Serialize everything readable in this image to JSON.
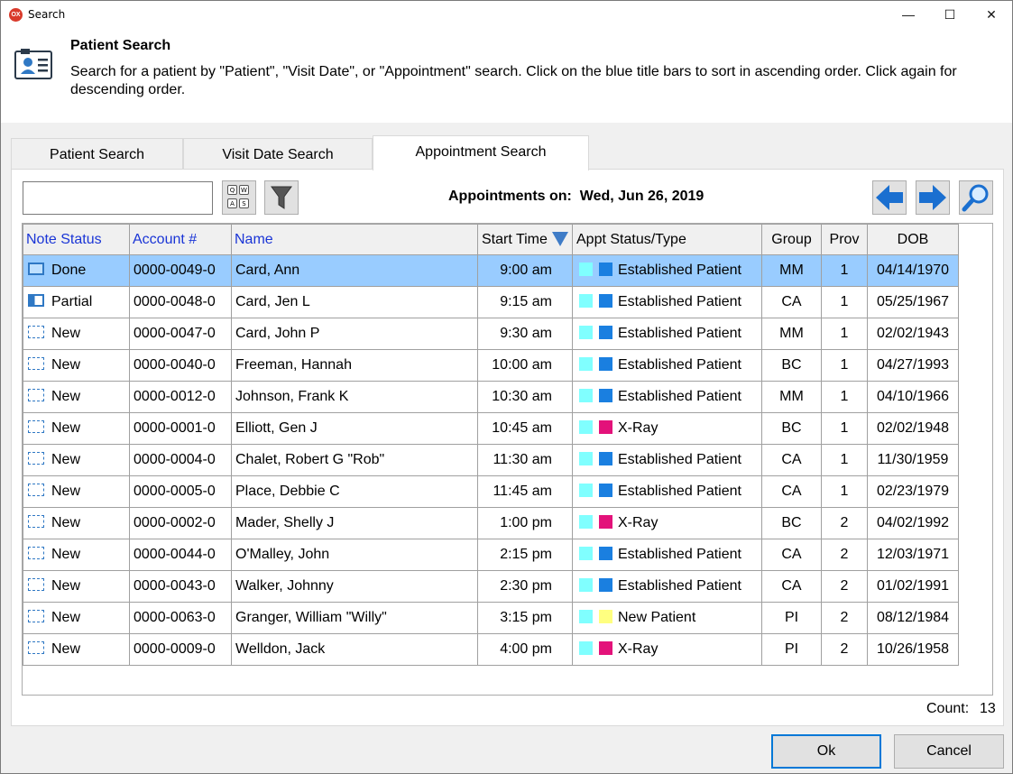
{
  "window": {
    "title": "Search",
    "app_icon": "OX"
  },
  "header": {
    "title": "Patient Search",
    "description": "Search for a patient by \"Patient\", \"Visit Date\", or \"Appointment\" search.  Click on the blue title bars to sort in ascending order.  Click again for descending order."
  },
  "tabs": [
    {
      "label": "Patient Search",
      "active": false
    },
    {
      "label": "Visit Date Search",
      "active": false
    },
    {
      "label": "Appointment Search",
      "active": true
    }
  ],
  "toolbar": {
    "search_value": "",
    "keyboard_keys": [
      "Q",
      "W",
      "A",
      "S"
    ],
    "appointments_label": "Appointments on:",
    "appointments_date": "Wed, Jun 26, 2019"
  },
  "grid": {
    "columns": [
      {
        "label": "Note Status",
        "sortable": true
      },
      {
        "label": "Account #",
        "sortable": true
      },
      {
        "label": "Name",
        "sortable": true
      },
      {
        "label": "Start Time",
        "sortable": false,
        "sorted": "descending"
      },
      {
        "label": "Appt Status/Type",
        "sortable": false
      },
      {
        "label": "Group",
        "sortable": false
      },
      {
        "label": "Prov",
        "sortable": false
      },
      {
        "label": "DOB",
        "sortable": false
      }
    ],
    "rows": [
      {
        "note": "Done",
        "account": "0000-0049-0",
        "name": "Card, Ann",
        "time": "9:00 am",
        "type": "Established Patient",
        "group": "MM",
        "prov": "1",
        "dob": "04/14/1970",
        "selected": true
      },
      {
        "note": "Partial",
        "account": "0000-0048-0",
        "name": "Card, Jen L",
        "time": "9:15 am",
        "type": "Established Patient",
        "group": "CA",
        "prov": "1",
        "dob": "05/25/1967"
      },
      {
        "note": "New",
        "account": "0000-0047-0",
        "name": "Card, John P",
        "time": "9:30 am",
        "type": "Established Patient",
        "group": "MM",
        "prov": "1",
        "dob": "02/02/1943"
      },
      {
        "note": "New",
        "account": "0000-0040-0",
        "name": "Freeman, Hannah",
        "time": "10:00 am",
        "type": "Established Patient",
        "group": "BC",
        "prov": "1",
        "dob": "04/27/1993"
      },
      {
        "note": "New",
        "account": "0000-0012-0",
        "name": "Johnson, Frank K",
        "time": "10:30 am",
        "type": "Established Patient",
        "group": "MM",
        "prov": "1",
        "dob": "04/10/1966"
      },
      {
        "note": "New",
        "account": "0000-0001-0",
        "name": "Elliott, Gen J",
        "time": "10:45 am",
        "type": "X-Ray",
        "group": "BC",
        "prov": "1",
        "dob": "02/02/1948"
      },
      {
        "note": "New",
        "account": "0000-0004-0",
        "name": "Chalet, Robert G \"Rob\"",
        "time": "11:30 am",
        "type": "Established Patient",
        "group": "CA",
        "prov": "1",
        "dob": "11/30/1959"
      },
      {
        "note": "New",
        "account": "0000-0005-0",
        "name": "Place, Debbie C",
        "time": "11:45 am",
        "type": "Established Patient",
        "group": "CA",
        "prov": "1",
        "dob": "02/23/1979"
      },
      {
        "note": "New",
        "account": "0000-0002-0",
        "name": "Mader, Shelly J",
        "time": "1:00 pm",
        "type": "X-Ray",
        "group": "BC",
        "prov": "2",
        "dob": "04/02/1992"
      },
      {
        "note": "New",
        "account": "0000-0044-0",
        "name": "O'Malley, John",
        "time": "2:15 pm",
        "type": "Established Patient",
        "group": "CA",
        "prov": "2",
        "dob": "12/03/1971"
      },
      {
        "note": "New",
        "account": "0000-0043-0",
        "name": "Walker, Johnny",
        "time": "2:30 pm",
        "type": "Established Patient",
        "group": "CA",
        "prov": "2",
        "dob": "01/02/1991"
      },
      {
        "note": "New",
        "account": "0000-0063-0",
        "name": "Granger, William \"Willy\"",
        "time": "3:15 pm",
        "type": "New Patient",
        "group": "PI",
        "prov": "2",
        "dob": "08/12/1984"
      },
      {
        "note": "New",
        "account": "0000-0009-0",
        "name": "Welldon, Jack",
        "time": "4:00 pm",
        "type": "X-Ray",
        "group": "PI",
        "prov": "2",
        "dob": "10/26/1958"
      }
    ]
  },
  "status_colors": {
    "Established Patient": "#1a7fe0",
    "X-Ray": "#e3127a",
    "New Patient": "#ffff80",
    "appt_status": "#80ffff",
    "selected_row": "#99ccff",
    "sortable_header_text": "#1a35d6"
  },
  "icons": {
    "note_done": "note-done-icon",
    "note_partial": "note-partial-icon",
    "note_new": "note-new-icon",
    "keyboard": "keyboard-icon",
    "filter": "filter-icon",
    "previous": "arrow-left-icon",
    "next": "arrow-right-icon",
    "find": "magnifier-icon",
    "header": "patient-card-icon"
  },
  "footer": {
    "count_label": "Count:",
    "count_value": "13",
    "ok_label": "Ok",
    "cancel_label": "Cancel"
  },
  "window_controls": {
    "minimize": "—",
    "maximize": "☐",
    "close": "✕"
  }
}
